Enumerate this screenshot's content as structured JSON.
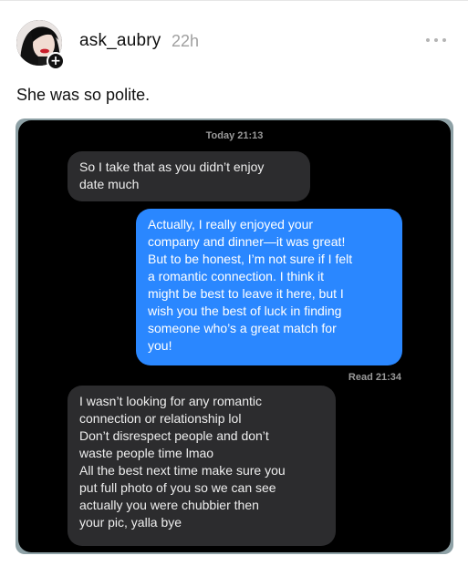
{
  "post": {
    "username": "ask_aubry",
    "time_ago": "22h",
    "caption": "She was so polite."
  },
  "conversation": {
    "timestamp": "Today 21:13",
    "read_receipt": "Read 21:34",
    "messages": [
      {
        "sender": "them",
        "lines": [
          "So I take that as you didn’t enjoy",
          "date much"
        ]
      },
      {
        "sender": "me",
        "lines": [
          "Actually, I really enjoyed your",
          "company and dinner—it was great!",
          "But to be honest, I’m not sure if I felt",
          "a romantic connection. I think it",
          "might be best to leave it here, but I",
          "wish you the best of luck in finding",
          "someone who’s a great match for",
          "you!"
        ]
      },
      {
        "sender": "them",
        "lines": [
          "I wasn’t looking for any romantic",
          "connection or relationship lol",
          "Don’t disrespect people and don’t",
          "waste people time lmao",
          "All the best next time make sure you",
          "put full photo of you so we can see",
          "actually you were chubbier then",
          "your pic, yalla bye"
        ]
      }
    ]
  },
  "icons": {
    "avatar": "profile-avatar",
    "follow": "plus-icon",
    "more": "more-options-icon"
  },
  "colors": {
    "outgoing_bubble": "#2a87ff",
    "incoming_bubble": "#2c2c2e",
    "screenshot_bg": "#000000",
    "frame_border": "#8ea1a6"
  }
}
